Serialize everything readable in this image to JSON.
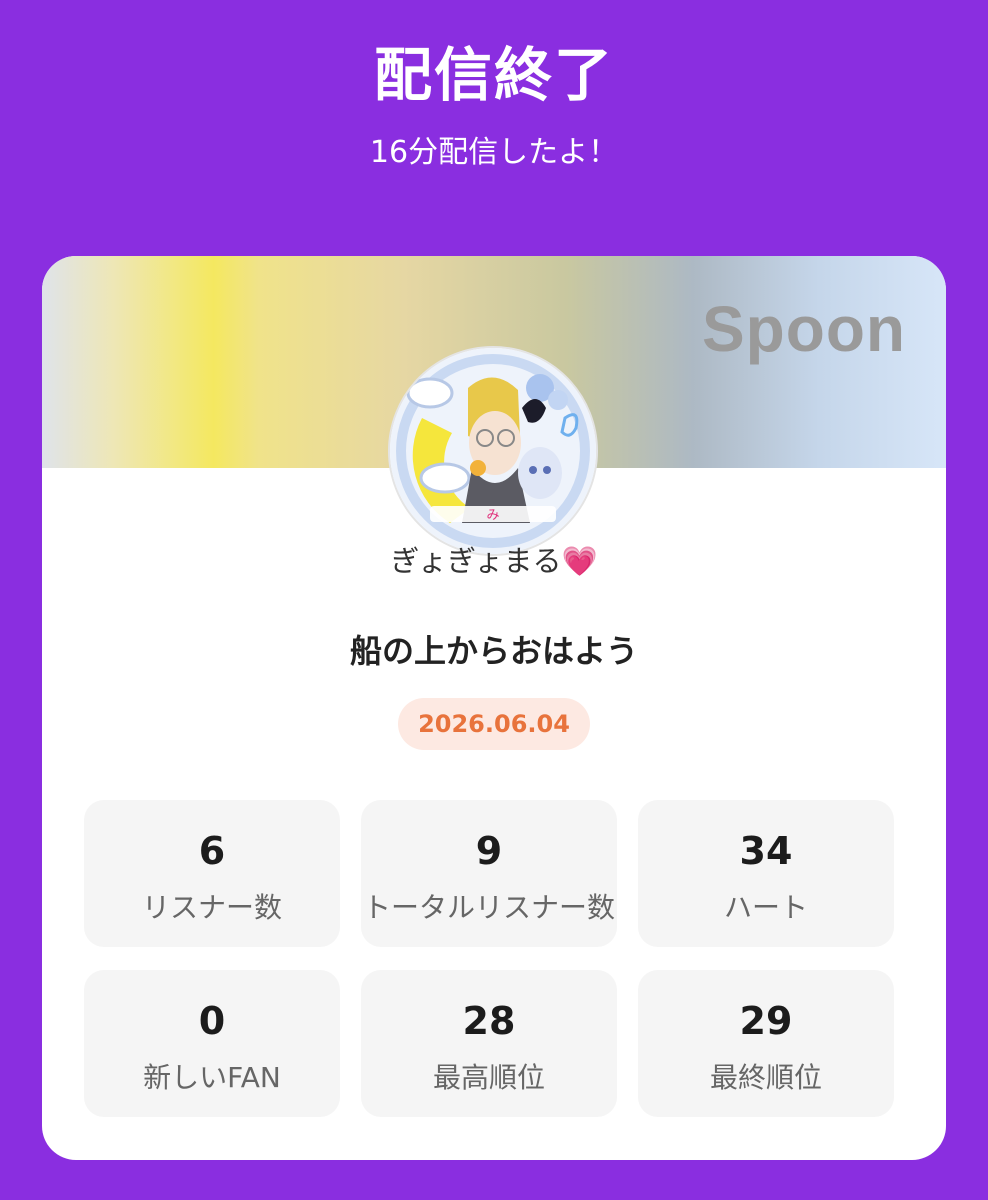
{
  "header": {
    "title": "配信終了",
    "subtitle": "16分配信したよ！"
  },
  "card": {
    "brand": "Spoon",
    "avatar_icon": "profile-avatar-image",
    "username": "ぎょぎょまる",
    "username_emoji": "💗",
    "broadcast_title": "船の上からおはよう",
    "date": "2026.06.04",
    "stats": [
      {
        "value": "6",
        "label": "リスナー数"
      },
      {
        "value": "9",
        "label": "トータルリスナー数"
      },
      {
        "value": "34",
        "label": "ハート"
      },
      {
        "value": "0",
        "label": "新しいFAN"
      },
      {
        "value": "28",
        "label": "最高順位"
      },
      {
        "value": "29",
        "label": "最終順位"
      }
    ]
  },
  "colors": {
    "background": "#8a2ee0",
    "date_badge_bg": "#fde9e2",
    "date_badge_text": "#e8733c",
    "stat_bg": "#f5f5f5"
  }
}
